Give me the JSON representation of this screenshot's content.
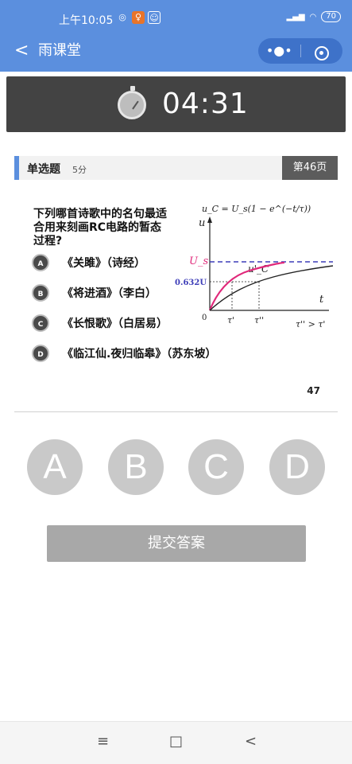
{
  "statusbar": {
    "time": "上午10:05",
    "battery": "70"
  },
  "navbar": {
    "back": "<",
    "title": "雨课堂",
    "more": "•●•"
  },
  "timer": {
    "value": "04:31"
  },
  "question": {
    "type": "单选题",
    "score": "5分",
    "page": "第46页",
    "text": "下列哪首诗歌中的名句最适合用来刻画RC电路的暂态过程?",
    "options": [
      {
        "letter": "A",
        "text": "《关雎》（诗经）"
      },
      {
        "letter": "B",
        "text": "《将进酒》（李白）"
      },
      {
        "letter": "C",
        "text": "《长恨歌》（白居易）"
      },
      {
        "letter": "D",
        "text": "《临江仙.夜归临皋》（苏东坡）"
      }
    ],
    "slide_number": "47"
  },
  "graph": {
    "formula": "u_C = U_s(1 − e^(−t/τ))",
    "u_label": "u",
    "us_label": "U_s",
    "level_label": "0.632U",
    "origin": "0",
    "t_label": "t",
    "uc_label": "u'_C",
    "tau1": "τ'",
    "tau2": "τ''",
    "relation": "τ'' > τ'",
    "colors": {
      "fast_curve": "#e0287a",
      "us_line": "#3d3db8",
      "level": "#3d3db8"
    }
  },
  "choices": [
    "A",
    "B",
    "C",
    "D"
  ],
  "submit_label": "提交答案",
  "system_nav": {
    "menu": "≡",
    "home": "□",
    "back": "<"
  }
}
